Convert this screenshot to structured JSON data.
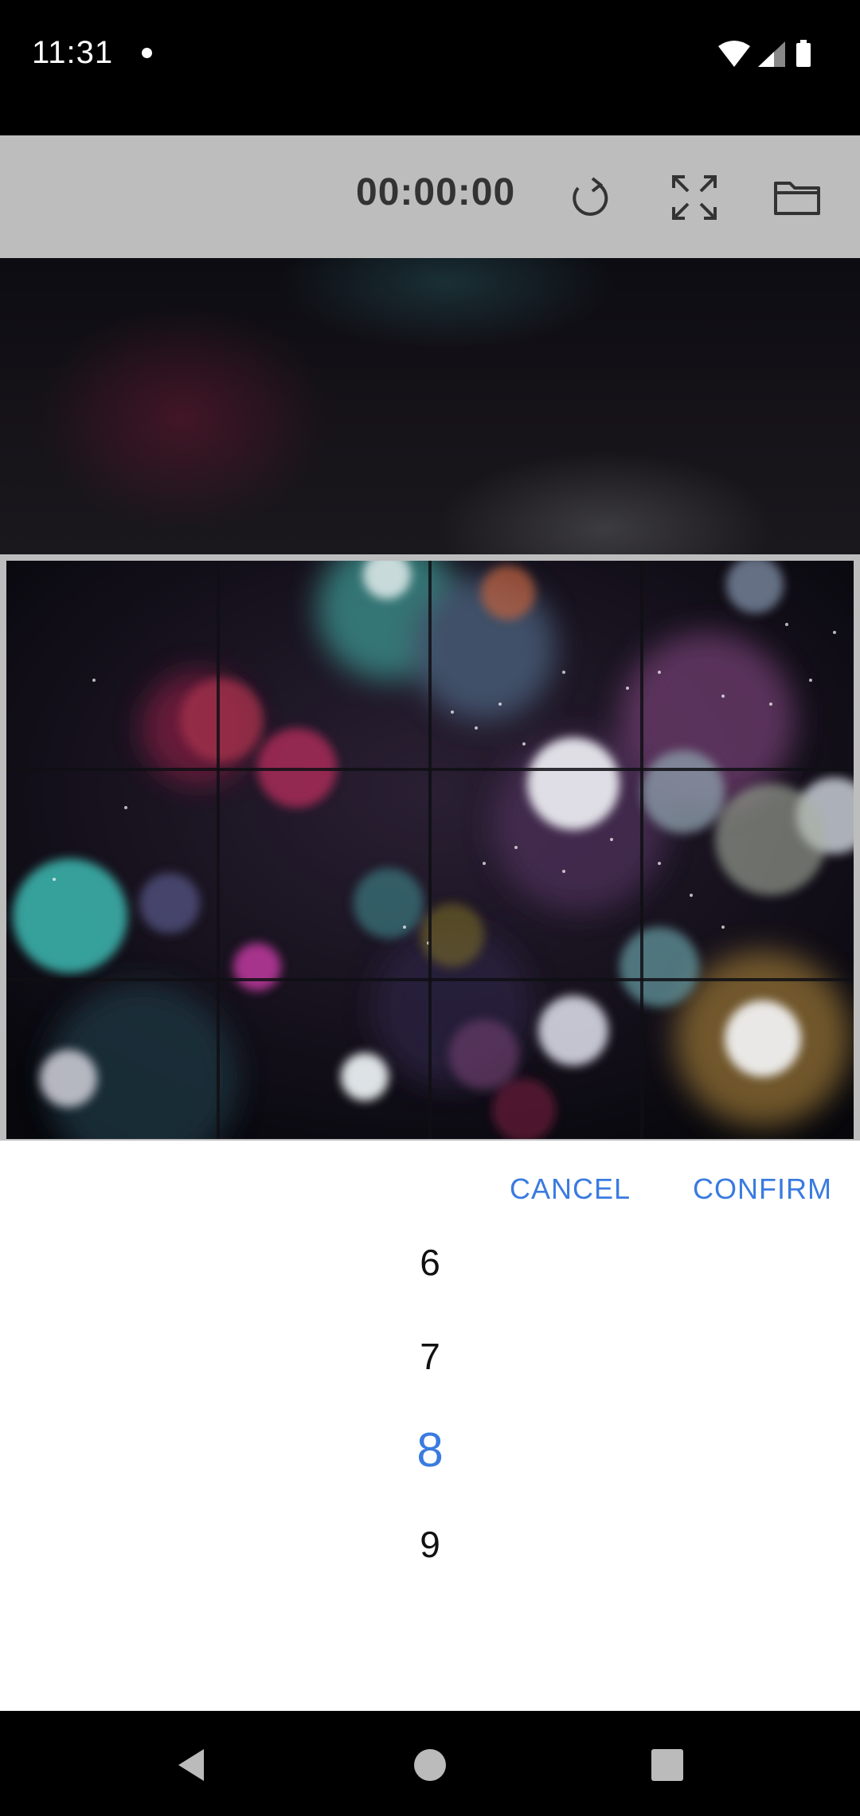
{
  "status_bar": {
    "time": "11:31",
    "icons": [
      "notification-dot-icon",
      "wifi-icon",
      "cell-signal-icon",
      "battery-icon"
    ]
  },
  "toolbar": {
    "timer": "00:00:00",
    "buttons": [
      "reload-icon",
      "expand-icon",
      "folder-icon"
    ]
  },
  "dialog": {
    "cancel_label": "CANCEL",
    "confirm_label": "CONFIRM",
    "picker": {
      "options": [
        "6",
        "7",
        "8",
        "9"
      ],
      "selected": "8"
    }
  },
  "nav_bar": {
    "buttons": [
      "back-icon",
      "home-icon",
      "recents-icon"
    ]
  },
  "colors": {
    "accent": "#3a7be0",
    "toolbar_bg": "#bdbdbd",
    "timer_text": "#333333"
  }
}
